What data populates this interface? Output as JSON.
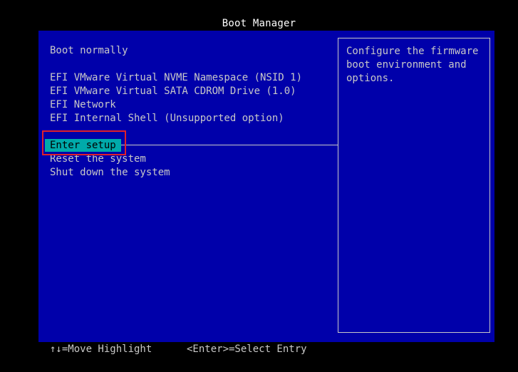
{
  "header": {
    "title": "Boot Manager"
  },
  "menu": {
    "items": [
      {
        "label": "Boot normally"
      },
      {
        "label": "EFI VMware Virtual NVME Namespace (NSID 1)"
      },
      {
        "label": "EFI VMware Virtual SATA CDROM Drive (1.0)"
      },
      {
        "label": "EFI Network"
      },
      {
        "label": "EFI Internal Shell (Unsupported option)"
      },
      {
        "label": "Enter setup",
        "selected": true
      },
      {
        "label": "Reset the system"
      },
      {
        "label": "Shut down the system"
      }
    ]
  },
  "help": {
    "text": "Configure the firmware boot environment and options."
  },
  "footer": {
    "move_hint": "↑↓=Move Highlight",
    "select_hint": "<Enter>=Select Entry"
  },
  "colors": {
    "background": "#0000aa",
    "highlight_bg": "#00aaaa",
    "text": "#c8c8c8",
    "annotation_box": "#e0202a"
  }
}
